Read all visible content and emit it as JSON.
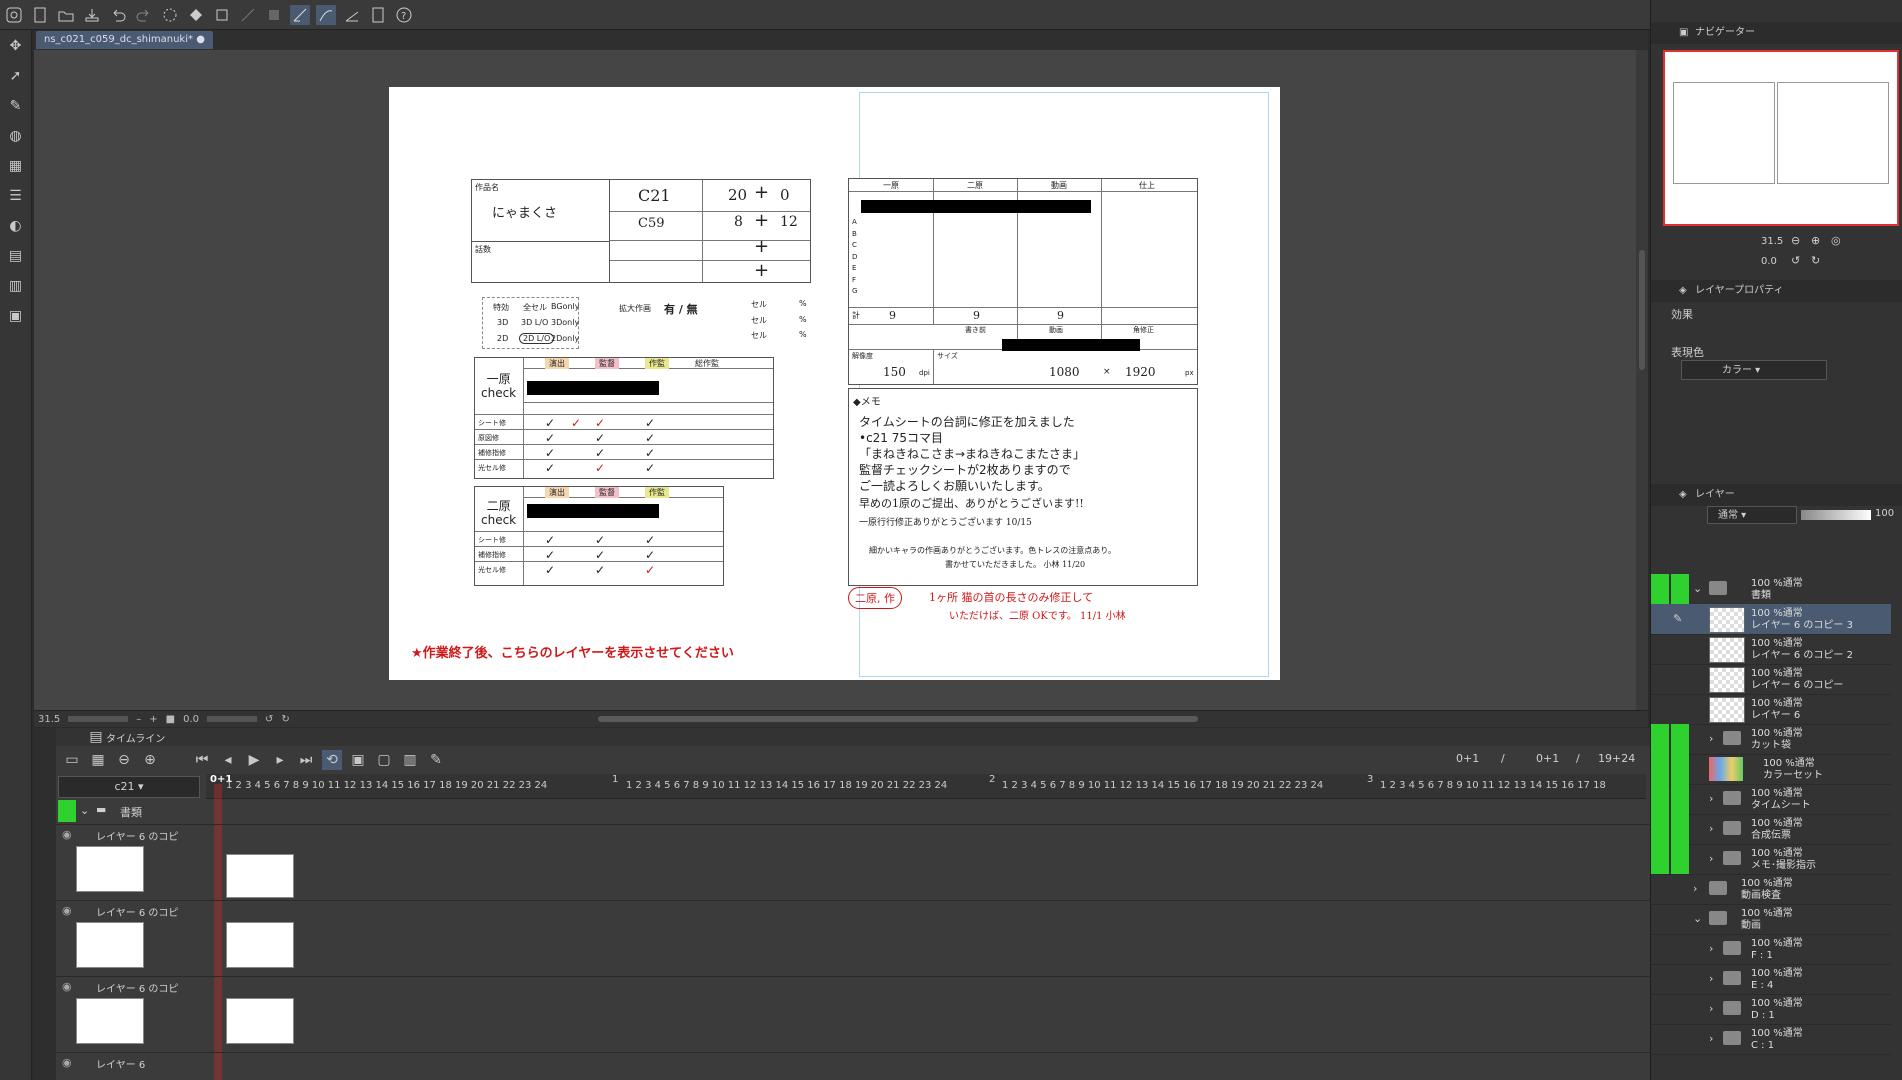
{
  "document": {
    "tab_title": "ns_c021_c059_dc_shimanuki*"
  },
  "status": {
    "zoom": "31.5",
    "rotation": "0.0"
  },
  "sheet": {
    "title_label": "作品名",
    "title_value": "にゃまくさ",
    "count_label": "話数",
    "cut1": "C21",
    "cut1_a": "20",
    "cut1_b": "0",
    "cut2": "C59",
    "cut2_a": "8",
    "cut2_b": "12",
    "plus": "+",
    "special_label": "特効",
    "opt_zensel": "全セル",
    "opt_bgonly": "BGonly",
    "opt_3d": "3D",
    "opt_3dlo": "3D L/O",
    "opt_3donly": "3Donly",
    "opt_2d": "2D",
    "opt_2dlo": "2D L/O",
    "opt_2donly": "2Donly",
    "enlarge_label": "拡大作画",
    "enlarge_value": "有 / 無",
    "cel_label": "セル",
    "percent": "%",
    "col_enshutsu": "演出",
    "col_kantoku": "監督",
    "col_sakkan": "作監",
    "col_sousakkan": "総作監",
    "ichigen_check": "一原\ncheck",
    "nigen_check": "二原\ncheck",
    "yes": "有",
    "no": "無",
    "row_sheet": "シート修",
    "row_genzu": "原図修",
    "row_hosei": "補修指修",
    "row_kousen": "光セル修",
    "hdr_ichido": "一原",
    "hdr_nido": "二原",
    "hdr_douga": "動画",
    "hdr_shiage": "仕上",
    "rows_letters": [
      "A",
      "B",
      "C",
      "D",
      "E",
      "F",
      "G"
    ],
    "total_label": "計",
    "total_values": [
      "9",
      "9",
      "9"
    ],
    "before_label": "書き前",
    "douga_label": "動画",
    "kakutei_label": "角修正",
    "res_label": "解像度",
    "res_value": "150",
    "res_unit": "dpi",
    "size_label": "サイズ",
    "size_w": "1080",
    "size_x": "×",
    "size_h": "1920",
    "size_unit": "px",
    "memo_label": "◆メモ",
    "memo_lines": [
      "タイムシートの台詞に修正を加えました",
      "•c21 75コマ目",
      "「まねきねこさま→まねきねこまたさま」",
      "監督チェックシートが2枚ありますので",
      "ご一読よろしくお願いいたします。",
      "早めの1原のご提出、ありがとうございます!!",
      "一原行行修正ありがとうございます 10/15",
      "細かいキャラの作画ありがとうございます。色トレスの注意点あり。",
      "書かせていただきました。 小林 11/20"
    ],
    "red_note_circle": "二原, 作",
    "red_note": "1ヶ所 猫の首の長さのみ修正して",
    "red_note2": "いただけば、二原 OKです。 11/1 小林",
    "footer_notice": "★作業終了後、こちらのレイヤーを表示させてください"
  },
  "timeline": {
    "panel_title": "タイムライン",
    "track_select": "c21",
    "current_frame": "0+1",
    "frame_display": "0+1",
    "sep": "/",
    "frame_display2": "0+1",
    "total": "19+24",
    "folder_name": "書類",
    "tracks": [
      {
        "name": "レイヤー 6 のコピ"
      },
      {
        "name": "レイヤー 6 のコピ"
      },
      {
        "name": "レイヤー 6 のコピ"
      },
      {
        "name": "レイヤー 6"
      }
    ],
    "second_markers": [
      "1",
      "2",
      "3"
    ],
    "frame_numbers": [
      "1",
      "2",
      "3",
      "4",
      "5",
      "6",
      "7",
      "8",
      "9",
      "10",
      "11",
      "12",
      "13",
      "14",
      "15",
      "16",
      "17",
      "18",
      "19",
      "20",
      "21",
      "22",
      "23",
      "24"
    ]
  },
  "navigator": {
    "title": "ナビゲーター",
    "zoom": "31.5",
    "rotate": "0.0"
  },
  "layer_property": {
    "title": "レイヤープロパティ",
    "effect_label": "効果",
    "color_label": "表現色",
    "color_value": "カラー"
  },
  "layers": {
    "title": "レイヤー",
    "blend_mode": "通常",
    "opacity": "100",
    "items": [
      {
        "mode": "100 %通常",
        "name": "書類",
        "type": "folder"
      },
      {
        "mode": "100 %通常",
        "name": "レイヤー 6 のコピー 3",
        "type": "layer"
      },
      {
        "mode": "100 %通常",
        "name": "レイヤー 6 のコピー 2",
        "type": "layer"
      },
      {
        "mode": "100 %通常",
        "name": "レイヤー 6 のコピー",
        "type": "layer"
      },
      {
        "mode": "100 %通常",
        "name": "レイヤー 6",
        "type": "layer"
      },
      {
        "mode": "100 %通常",
        "name": "カット袋",
        "type": "folder"
      },
      {
        "mode": "100 %通常",
        "name": "カラーセット",
        "type": "layer"
      },
      {
        "mode": "100 %通常",
        "name": "タイムシート",
        "type": "folder"
      },
      {
        "mode": "100 %通常",
        "name": "合成伝票",
        "type": "folder"
      },
      {
        "mode": "100 %通常",
        "name": "メモ･撮影指示",
        "type": "folder"
      },
      {
        "mode": "100 %通常",
        "name": "動画検査",
        "type": "folder"
      },
      {
        "mode": "100 %通常",
        "name": "動画",
        "type": "folder"
      },
      {
        "mode": "100 %通常",
        "name": "F : 1",
        "type": "folder"
      },
      {
        "mode": "100 %通常",
        "name": "E : 4",
        "type": "folder"
      },
      {
        "mode": "100 %通常",
        "name": "D : 1",
        "type": "folder"
      },
      {
        "mode": "100 %通常",
        "name": "C : 1",
        "type": "folder"
      }
    ]
  },
  "colors": {
    "accent_green": "#2fd12f",
    "note_red": "#d01818",
    "selected": "#4a5a70"
  }
}
